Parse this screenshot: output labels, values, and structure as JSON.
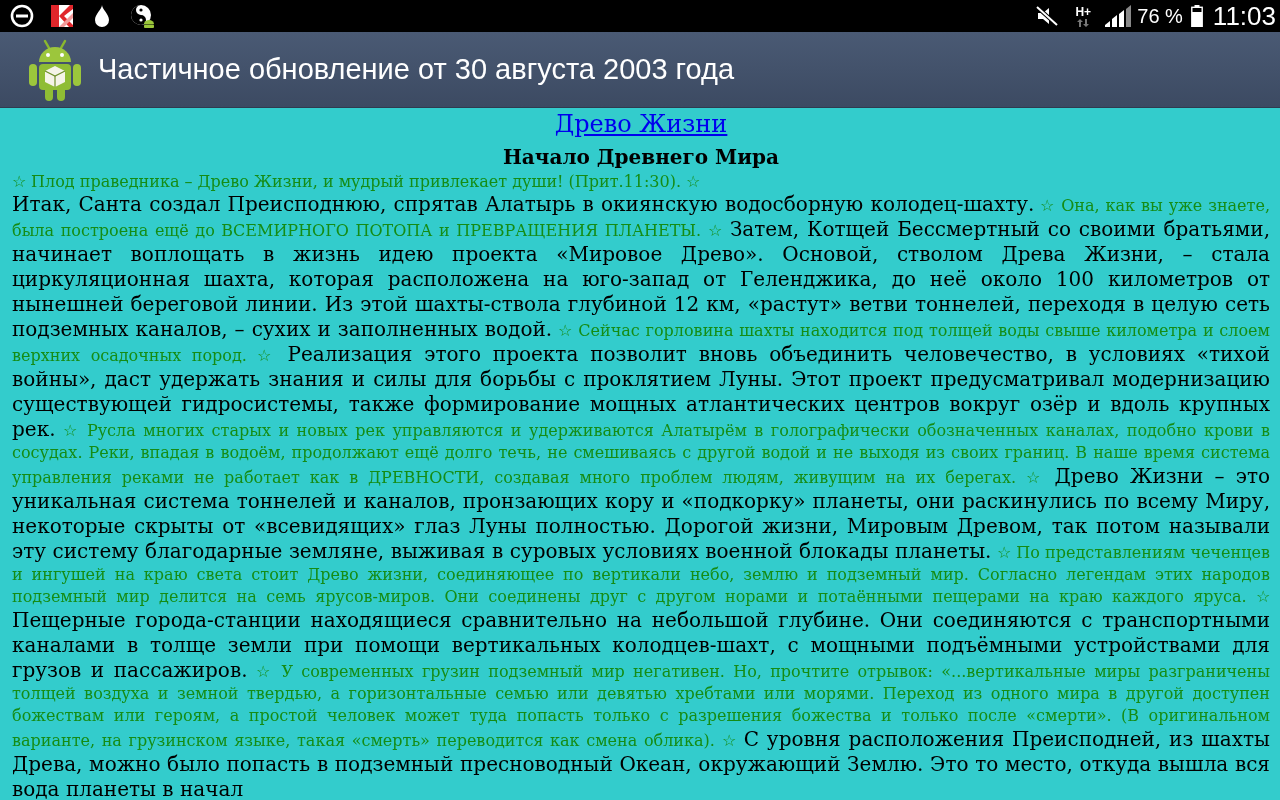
{
  "status_bar": {
    "network": "H+",
    "battery": "76 %",
    "time": "11:03"
  },
  "action_bar": {
    "title": "Частичное обновление от 30 августа 2003 года"
  },
  "article": {
    "title_link": "Древо Жизни",
    "heading": "Начало Древнего Мира",
    "epigraph": "☆ Плод праведника – Древо Жизни, и мудрый привлекает души! (Прит.11:30). ☆",
    "segments": [
      {
        "kind": "text",
        "text": "Итак, Санта создал Преисподнюю, спрятав Алатырь в окиянскую водосборную колодец-шахту."
      },
      {
        "kind": "note",
        "text": "☆ Она, как вы уже знаете, была построена ещё до ВСЕМИРНОГО ПОТОПА и ПРЕВРАЩЕНИЯ ПЛАНЕТЫ. ☆"
      },
      {
        "kind": "text",
        "text": "Затем, Котщей Бессмертный со своими братьями, начинает воплощать в жизнь идею проекта «Мировое Древо». Основой, стволом Древа Жизни, – стала циркуляционная шахта, которая расположена на юго-запад от Геленджика, до неё около 100 километров от нынешней береговой линии. Из этой шахты-ствола глубиной 12 км, «растут» ветви тоннелей, переходя в целую сеть подземных каналов, – сухих и заполненных водой."
      },
      {
        "kind": "note",
        "text": "☆ Сейчас горловина шахты находится под толщей воды свыше километра и слоем верхних осадочных пород. ☆"
      },
      {
        "kind": "text",
        "text": "Реализация этого проекта позволит вновь объединить человечество, в условиях «тихой войны», даст удержать знания и силы для борьбы с проклятием Луны. Этот проект предусматривал модернизацию существующей гидросистемы, также формирование мощных атлантических центров вокруг озёр и вдоль крупных рек."
      },
      {
        "kind": "note",
        "text": "☆ Русла многих старых и новых рек управляются и удерживаются Алатырём в голографически обозначенных каналах, подобно крови в сосудах. Реки, впадая в водоём, продолжают ещё долго течь, не смешиваясь с другой водой и не выходя из своих границ. В наше время система управления реками не работает как в ДРЕВНОСТИ, создавая много проблем людям, живущим на их берегах. ☆"
      },
      {
        "kind": "text",
        "text": "Древо Жизни – это уникальная система тоннелей и каналов, пронзающих кору и «подкорку» планеты, они раскинулись по всему Миру, некоторые скрыты от «всевидящих» глаз Луны полностью. Дорогой жизни, Мировым Древом, так потом называли эту систему благодарные земляне, выживая в суровых условиях военной блокады планеты."
      },
      {
        "kind": "note",
        "text": "☆ По представлениям чеченцев и ингушей на краю света стоит Древо жизни, соединяющее по вертикали небо, землю и подземный мир. Согласно легендам этих народов подземный мир делится на семь ярусов-миров. Они соединены друг с другом норами и потаёнными пещерами на краю каждого яруса. ☆"
      },
      {
        "kind": "text",
        "text": "Пещерные города-станции находящиеся сравнительно на небольшой глубине. Они соединяются с транспортными каналами в толще земли при помощи вертикальных колодцев-шахт, с мощными подъёмными устройствами для грузов и пассажиров."
      },
      {
        "kind": "note",
        "text": "☆ У современных грузин подземный мир негативен. Но, прочтите отрывок: «...вертикальные миры разграничены толщей воздуха и земной твердью, а горизонтальные семью или девятью хребтами или морями. Переход из одного мира в другой доступен божествам или героям, а простой человек может туда попасть только с разрешения божества и только после «смерти». (В оригинальном варианте, на грузинском языке, такая «смерть» переводится как смена облика). ☆"
      },
      {
        "kind": "text",
        "text": "С уровня расположения Преисподней, из шахты Древа, можно было попасть в подземный пресноводный Океан, окружающий Землю. Это то место, откуда вышла вся вода планеты в начал"
      }
    ]
  }
}
